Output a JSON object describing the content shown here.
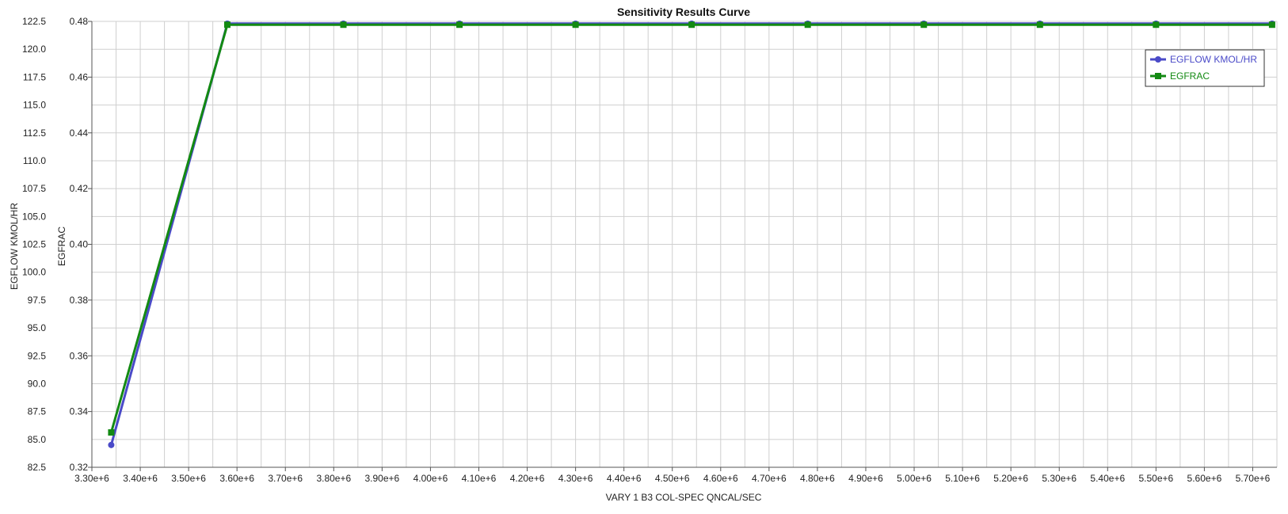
{
  "chart_data": {
    "type": "line",
    "title": "Sensitivity Results Curve",
    "xlabel": "VARY   1 B3 COL-SPEC QNCAL/SEC",
    "ylabel_left": "EGFLOW KMOL/HR",
    "ylabel_right": "EGFRAC",
    "xlim": [
      3300000,
      5750000
    ],
    "ylim_left": [
      82.5,
      122.5
    ],
    "ylim_right": [
      0.32,
      0.48
    ],
    "x_ticks": [
      "3.30e+6",
      "3.40e+6",
      "3.50e+6",
      "3.60e+6",
      "3.70e+6",
      "3.80e+6",
      "3.90e+6",
      "4.00e+6",
      "4.10e+6",
      "4.20e+6",
      "4.30e+6",
      "4.40e+6",
      "4.50e+6",
      "4.60e+6",
      "4.70e+6",
      "4.80e+6",
      "4.90e+6",
      "5.00e+6",
      "5.10e+6",
      "5.20e+6",
      "5.30e+6",
      "5.40e+6",
      "5.50e+6",
      "5.60e+6",
      "5.70e+6"
    ],
    "y_ticks_left": [
      "82.5",
      "85.0",
      "87.5",
      "90.0",
      "92.5",
      "95.0",
      "97.5",
      "100.0",
      "102.5",
      "105.0",
      "107.5",
      "110.0",
      "112.5",
      "115.0",
      "117.5",
      "120.0",
      "122.5"
    ],
    "y_ticks_right": [
      "0.32",
      "0.34",
      "0.36",
      "0.38",
      "0.40",
      "0.42",
      "0.44",
      "0.46",
      "0.48"
    ],
    "x": [
      3340000,
      3580000,
      3820000,
      4060000,
      4300000,
      4540000,
      4780000,
      5020000,
      5260000,
      5500000,
      5740000
    ],
    "series": [
      {
        "name": "EGFLOW KMOL/HR",
        "axis": "left",
        "color": "#4a4ac8",
        "marker": "circle",
        "values": [
          84.5,
          122.3,
          122.3,
          122.3,
          122.3,
          122.3,
          122.3,
          122.3,
          122.3,
          122.3,
          122.3
        ]
      },
      {
        "name": "EGFRAC",
        "axis": "right",
        "color": "#138a13",
        "marker": "square",
        "values": [
          0.3325,
          0.4788,
          0.4788,
          0.4788,
          0.4788,
          0.4788,
          0.4788,
          0.4788,
          0.4788,
          0.4788,
          0.4788
        ]
      }
    ],
    "grid": true,
    "legend_position": "top-right"
  }
}
